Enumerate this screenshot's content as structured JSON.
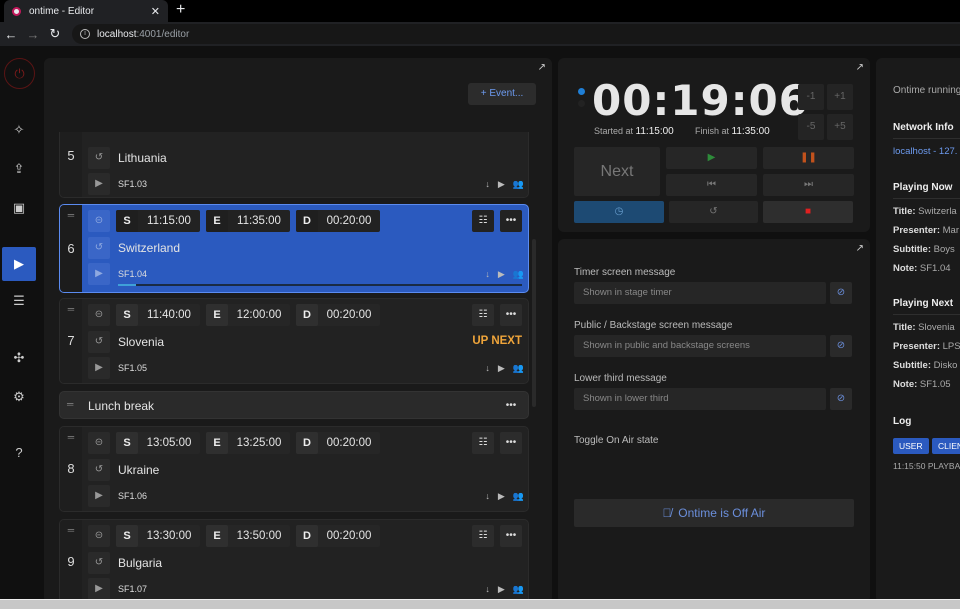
{
  "browser": {
    "tab_title": "ontime - Editor",
    "url_host": "localhost",
    "url_path": ":4001/editor"
  },
  "sidebar": {
    "items": [
      {
        "icon": "power-icon"
      },
      {
        "icon": "magic-wand-icon"
      },
      {
        "icon": "upload-icon"
      },
      {
        "icon": "save-icon"
      },
      {
        "icon": "play-icon",
        "active": true
      },
      {
        "icon": "sliders-icon"
      },
      {
        "icon": "puzzle-icon"
      },
      {
        "icon": "gear-icon"
      },
      {
        "icon": "help-icon",
        "label": "?"
      }
    ]
  },
  "rundown": {
    "add_event_label": "+ Event...",
    "events": [
      {
        "num": "5",
        "title": "Lithuania",
        "note": "SF1.03"
      },
      {
        "num": "6",
        "start": "11:15:00",
        "end": "11:35:00",
        "duration": "00:20:00",
        "title": "Switzerland",
        "note": "SF1.04",
        "selected": true,
        "progress": 0.045
      },
      {
        "num": "7",
        "start": "11:40:00",
        "end": "12:00:00",
        "duration": "00:20:00",
        "title": "Slovenia",
        "note": "SF1.05",
        "badge": "UP NEXT"
      },
      {
        "block": "Lunch break"
      },
      {
        "num": "8",
        "start": "13:05:00",
        "end": "13:25:00",
        "duration": "00:20:00",
        "title": "Ukraine",
        "note": "SF1.06"
      },
      {
        "num": "9",
        "start": "13:30:00",
        "end": "13:50:00",
        "duration": "00:20:00",
        "title": "Bulgaria",
        "note": "SF1.07"
      }
    ],
    "keys": {
      "start": "S",
      "end": "E",
      "duration": "D"
    }
  },
  "timer": {
    "clock": "00:19:06",
    "started_label": "Started at",
    "started_value": "11:15:00",
    "finish_label": "Finish at",
    "finish_value": "11:35:00",
    "adjust": [
      "-1",
      "+1",
      "-5",
      "+5"
    ],
    "next_label": "Next"
  },
  "messages": {
    "timer_label": "Timer screen message",
    "timer_placeholder": "Shown in stage timer",
    "public_label": "Public / Backstage screen message",
    "public_placeholder": "Shown in public and backstage screens",
    "lower_label": "Lower third message",
    "lower_placeholder": "Shown in lower third",
    "onair_label": "Toggle On Air state",
    "onair_button": "Ontime is Off Air"
  },
  "info": {
    "running": "Ontime running",
    "network_header": "Network Info",
    "network_link": "localhost - 127.",
    "now_header": "Playing Now",
    "now": {
      "title": "Switzerla",
      "presenter": "Mar",
      "subtitle": "Boys",
      "note": "SF1.04"
    },
    "next_header": "Playing Next",
    "next": {
      "title": "Slovenia",
      "presenter": "LPS",
      "subtitle": "Disko",
      "note": "SF1.05"
    },
    "labels": {
      "title": "Title:",
      "presenter": "Presenter:",
      "subtitle": "Subtitle:",
      "note": "Note:"
    },
    "log_header": "Log",
    "log_filters": [
      "USER",
      "CLIEN"
    ],
    "log_line": "11:15:50  PLAYBA"
  },
  "colors": {
    "accent": "#2b5abf",
    "up_next": "#f0a53a",
    "stop": "#e02020",
    "play": "#2e8b3a",
    "pause": "#c2521c"
  }
}
